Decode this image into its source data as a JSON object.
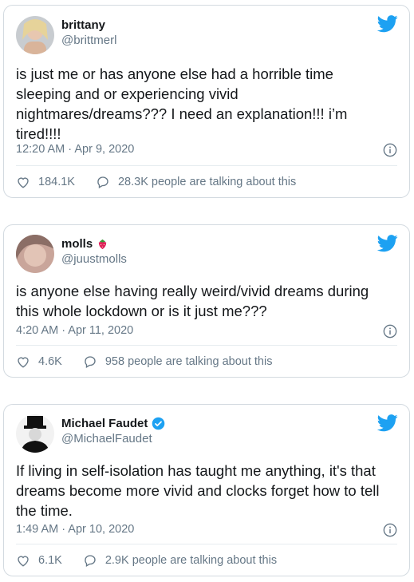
{
  "tweets": [
    {
      "name": "brittany",
      "handle": "@brittmerl",
      "text": "is just me or has anyone else had a horrible time sleeping and or experiencing vivid nightmares/dreams??? I need an explanation!!! i’m tired!!!!",
      "timestamp": "12:20 AM · Apr 9, 2020",
      "likes": "184.1K",
      "talking": "28.3K people are talking about this"
    },
    {
      "name": "molls",
      "name_emoji": "strawberry-icon",
      "handle": "@juustmolls",
      "text": "is anyone else having really weird/vivid dreams during this whole lockdown or is it just me???",
      "timestamp": "4:20 AM · Apr 11, 2020",
      "likes": "4.6K",
      "talking": "958 people are talking about this"
    },
    {
      "name": "Michael Faudet",
      "verified": true,
      "handle": "@MichaelFaudet",
      "text": "If living in self-isolation has taught me anything, it's that dreams become more vivid and clocks forget how to tell the time.",
      "timestamp": "1:49 AM · Apr 10, 2020",
      "likes": "6.1K",
      "talking": "2.9K people are talking about this"
    }
  ],
  "colors": {
    "twitter_blue": "#1da1f2",
    "gray": "#657786",
    "border": "#d3dae0",
    "strawberry": "#e0245e"
  }
}
